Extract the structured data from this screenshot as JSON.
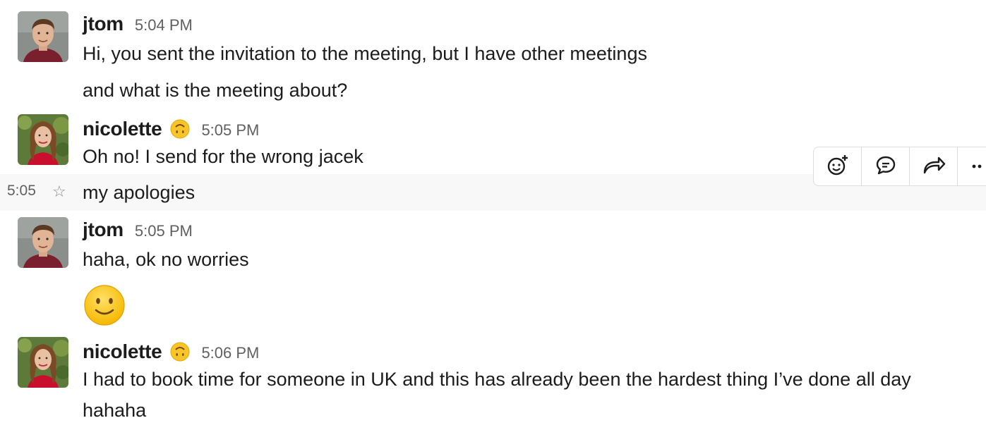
{
  "messages": [
    {
      "author": "jtom",
      "time": "5:04 PM",
      "lines": [
        "Hi, you sent the invitation to the meeting, but I have other meetings",
        "and what is the meeting about?"
      ]
    },
    {
      "author": "nicolette",
      "status_emoji": "upside-down-face",
      "time": "5:05 PM",
      "lines": [
        "Oh no! I send for the wrong jacek"
      ],
      "continuation": {
        "time": "5:05",
        "text": "my apologies"
      }
    },
    {
      "author": "jtom",
      "time": "5:05 PM",
      "lines": [
        "haha, ok no worries"
      ],
      "emoji": "slightly-smiling-face"
    },
    {
      "author": "nicolette",
      "status_emoji": "upside-down-face",
      "time": "5:06 PM",
      "lines": [
        "I had to book time for someone in UK and this has already been the hardest thing I’ve done all day hahaha"
      ]
    }
  ],
  "toolbar": {
    "icons": [
      "add-reaction-icon",
      "reply-thread-icon",
      "share-message-icon",
      "more-actions-icon"
    ]
  },
  "colors": {
    "hover_row": "#f8f8f8",
    "text": "#1d1c1d",
    "muted": "#616061",
    "emoji_yellow": "#f7c52a"
  }
}
